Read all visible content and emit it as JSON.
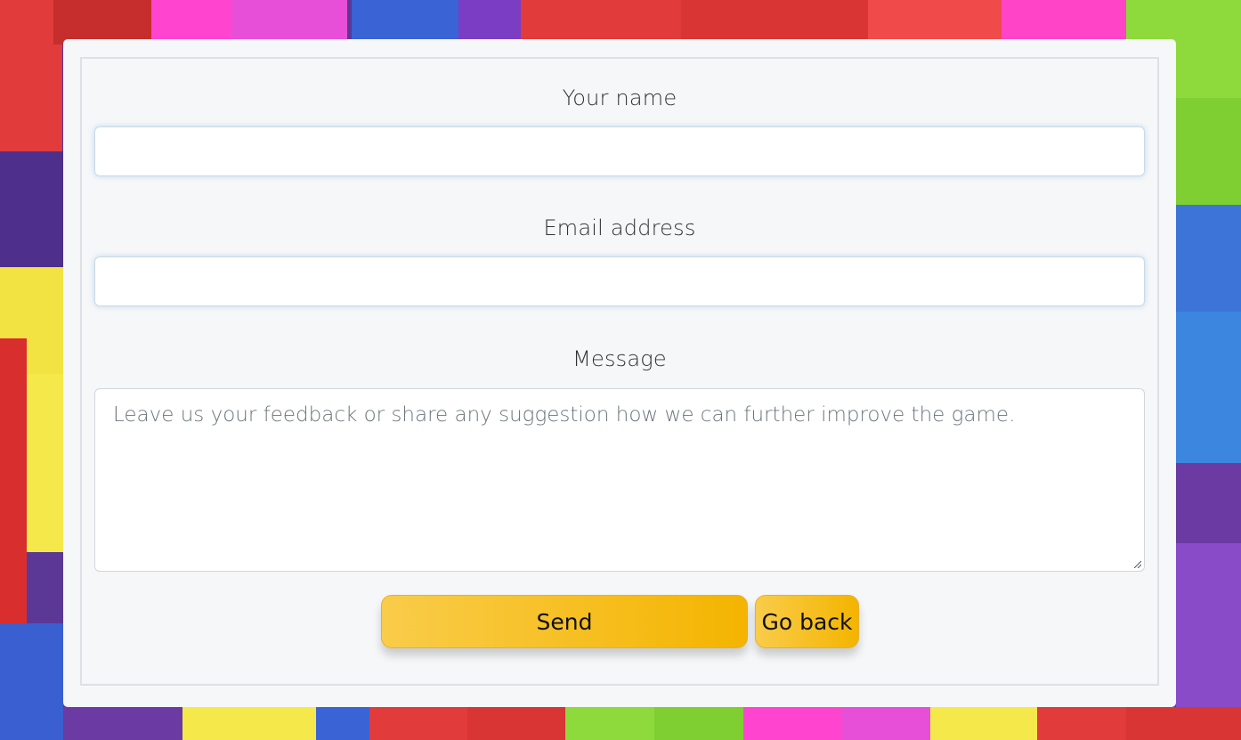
{
  "form": {
    "name_label": "Your name",
    "name_value": "",
    "email_label": "Email address",
    "email_value": "",
    "message_label": "Message",
    "message_placeholder": "Leave us your feedback or share any suggestion how we can further improve the game."
  },
  "buttons": {
    "send_label": "Send",
    "back_label": "Go back"
  },
  "colors": {
    "button_gradient_start": "#f9cc4a",
    "button_gradient_end": "#f4b400",
    "card_background": "#f5f7f9"
  }
}
